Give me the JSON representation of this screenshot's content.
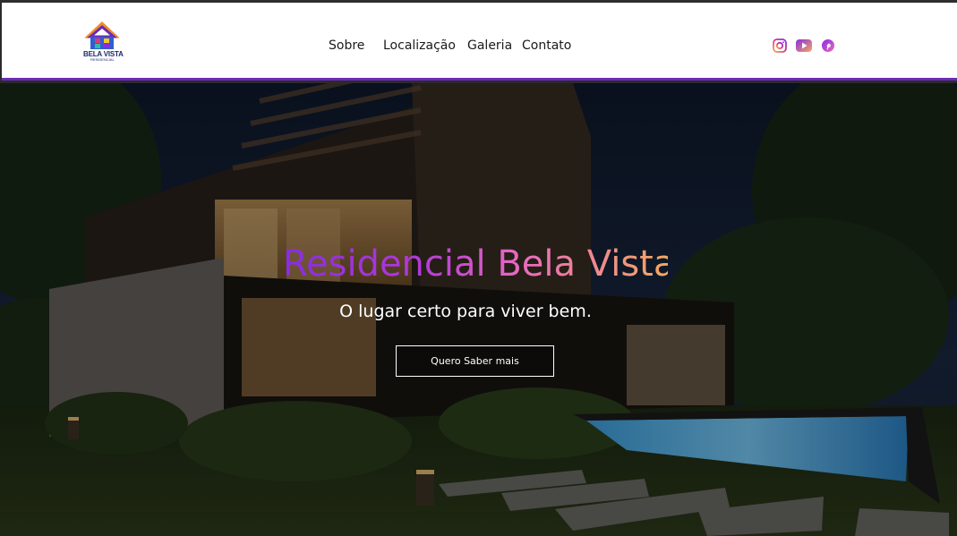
{
  "header": {
    "logo": {
      "title": "BELA VISTA",
      "subtitle": "RESIDENCIAL"
    },
    "nav": [
      {
        "label": "Sobre"
      },
      {
        "label": "Localização"
      },
      {
        "label": "Galeria"
      },
      {
        "label": "Contato"
      }
    ],
    "social": [
      {
        "icon": "instagram-icon"
      },
      {
        "icon": "youtube-icon"
      },
      {
        "icon": "pinterest-icon"
      }
    ],
    "accent_color": "#6b2bb7"
  },
  "hero": {
    "title": "Residencial Bela Vista",
    "subtitle": "O lugar certo para viver bem.",
    "cta_label": "Quero Saber mais",
    "title_gradient": [
      "#8a2be2",
      "#e86bbf",
      "#f4a860"
    ]
  }
}
